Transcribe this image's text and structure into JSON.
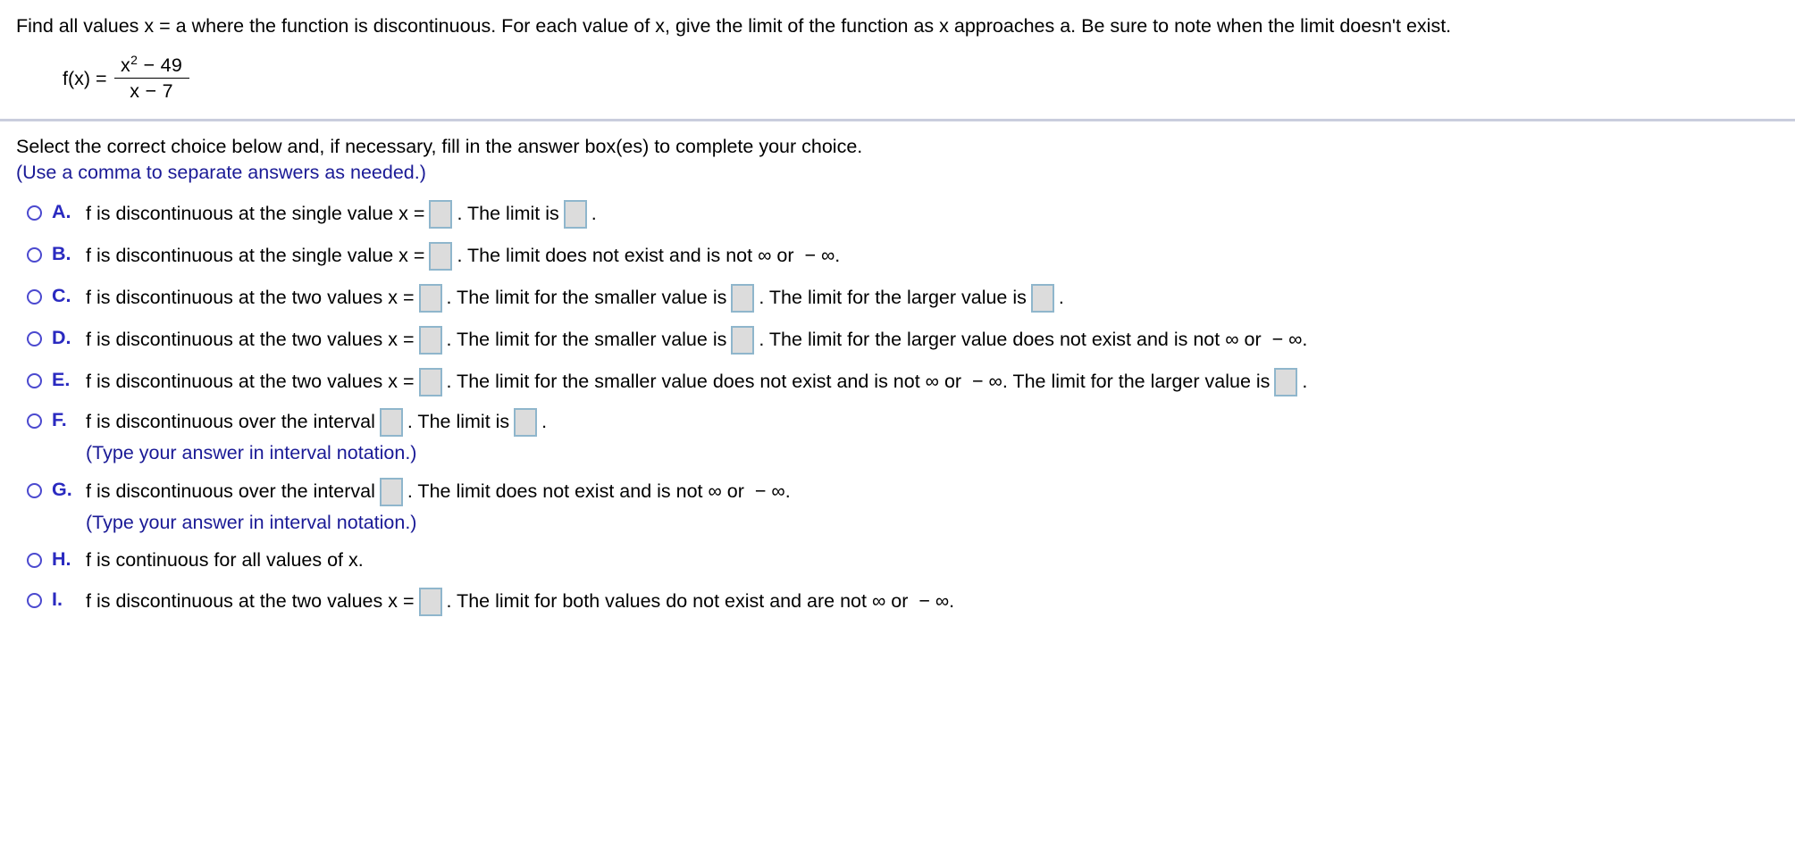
{
  "question": {
    "prompt": "Find all values x = a where the function is discontinuous. For each value of x, give the limit of the function as x approaches a. Be sure to note when the limit doesn't exist.",
    "formula": {
      "lhs": "f(x) =",
      "numerator_base": "x",
      "numerator_exponent": "2",
      "numerator_rest": " − 49",
      "denominator": "x − 7"
    }
  },
  "instructions": {
    "line1": "Select the correct choice below and, if necessary, fill in the answer box(es) to complete your choice.",
    "line2": "(Use a comma to separate answers as needed.)"
  },
  "choices": [
    {
      "letter": "A.",
      "segments": [
        "f is discontinuous at the single value x =",
        ". The limit is",
        "."
      ],
      "boxes": 2
    },
    {
      "letter": "B.",
      "segments": [
        "f is discontinuous at the single value x =",
        ". The limit does not exist and is not ∞ or  − ∞."
      ],
      "boxes": 1
    },
    {
      "letter": "C.",
      "segments": [
        "f is discontinuous at the two values x =",
        ". The limit for the smaller value is",
        ". The limit for the larger value is",
        "."
      ],
      "boxes": 3
    },
    {
      "letter": "D.",
      "segments": [
        "f is discontinuous at the two values x =",
        ". The limit for the smaller value is",
        ". The limit for the larger value does not exist and is not ∞ or  − ∞."
      ],
      "boxes": 2
    },
    {
      "letter": "E.",
      "segments": [
        "f is discontinuous at the two values x =",
        ". The limit for the smaller value does not exist and is not ∞ or  − ∞. The limit for the larger value is",
        "."
      ],
      "boxes": 2
    },
    {
      "letter": "F.",
      "segments": [
        "f is discontinuous over the interval",
        ". The limit is",
        "."
      ],
      "boxes": 2,
      "note": "(Type your answer in interval notation.)"
    },
    {
      "letter": "G.",
      "segments": [
        "f is discontinuous over the interval",
        ". The limit does not exist and is not ∞ or  − ∞."
      ],
      "boxes": 1,
      "note": "(Type your answer in interval notation.)"
    },
    {
      "letter": "H.",
      "segments": [
        "f is continuous for all values of x."
      ],
      "boxes": 0
    },
    {
      "letter": "I.",
      "segments": [
        "f is discontinuous at the two values x =",
        ". The limit for both values do not exist and are not ∞ or  − ∞."
      ],
      "boxes": 1
    }
  ],
  "colors": {
    "choice_letter": "#2a2ac0",
    "radio_ring": "#4b49cf",
    "hint_text": "#1a1a96",
    "answer_box_fill": "#dcdcdc",
    "answer_box_border": "#8fb6cc",
    "divider": "#c9cddd"
  }
}
